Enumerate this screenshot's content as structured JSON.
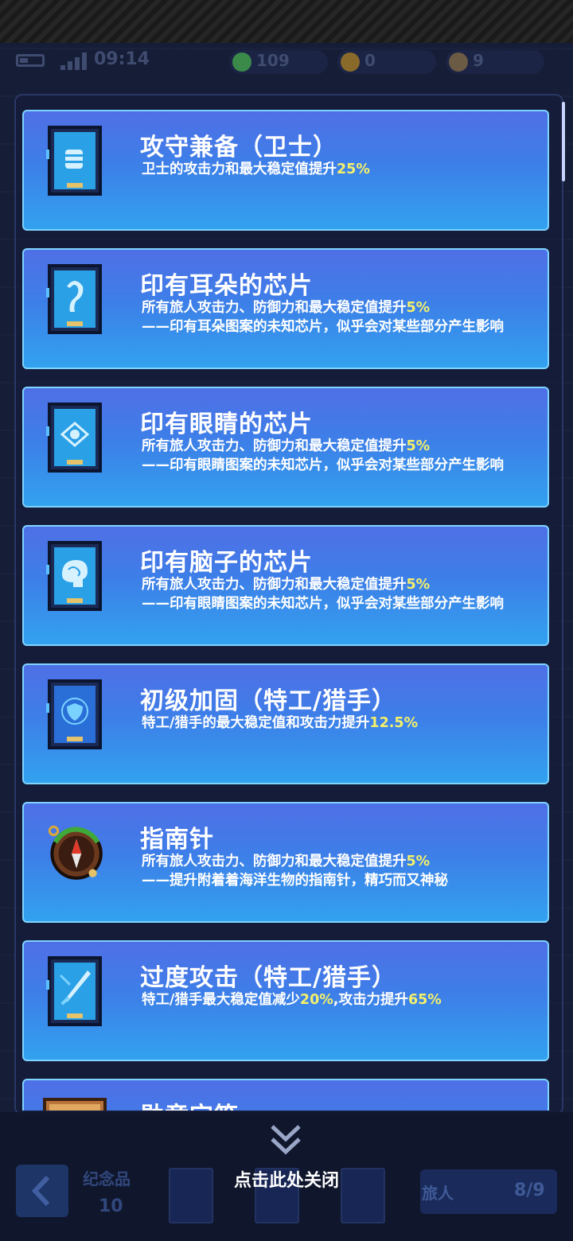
{
  "status": {
    "time": "09:14"
  },
  "currencies": [
    {
      "amount": "109",
      "icon": "green-gem-icon",
      "color": "#3c8a4a"
    },
    {
      "amount": "0",
      "icon": "gold-coin-icon",
      "color": "#8a6a2a"
    },
    {
      "amount": "9",
      "icon": "bronze-coin-icon",
      "color": "#6b5a44"
    }
  ],
  "cards": [
    {
      "title": "攻守兼备（卫士）",
      "desc_pre": "卫士的攻击力和最大稳定值提升",
      "desc_hl": "25%",
      "flavor": "",
      "icon": "chip-canister-icon"
    },
    {
      "title": "印有耳朵的芯片",
      "desc_pre": "所有旅人攻击力、防御力和最大稳定值提升",
      "desc_hl": "5%",
      "flavor": "——印有耳朵图案的未知芯片，似乎会对某些部分产生影响",
      "icon": "chip-ear-icon"
    },
    {
      "title": "印有眼睛的芯片",
      "desc_pre": "所有旅人攻击力、防御力和最大稳定值提升",
      "desc_hl": "5%",
      "flavor": "——印有眼睛图案的未知芯片，似乎会对某些部分产生影响",
      "icon": "chip-eye-icon"
    },
    {
      "title": "印有脑子的芯片",
      "desc_pre": "所有旅人攻击力、防御力和最大稳定值提升",
      "desc_hl": "5%",
      "flavor": "——印有眼睛图案的未知芯片，似乎会对某些部分产生影响",
      "icon": "chip-brain-icon"
    },
    {
      "title": "初级加固（特工/猎手）",
      "desc_pre": "特工/猎手的最大稳定值和攻击力提升",
      "desc_hl": "12.5%",
      "flavor": "",
      "icon": "chip-shield-icon"
    },
    {
      "title": "指南针",
      "desc_pre": "所有旅人攻击力、防御力和最大稳定值提升",
      "desc_hl": "5%",
      "flavor": "——提升附着着海洋生物的指南针，精巧而又神秘",
      "icon": "compass-icon"
    },
    {
      "title": "过度攻击（特工/猎手）",
      "desc_pre": "特工/猎手最大稳定值减少",
      "desc_hl": "20%",
      "desc_mid": ",攻击力提升",
      "desc_hl2": "65%",
      "flavor": "",
      "icon": "chip-sword-icon"
    },
    {
      "title": "勋章宝箱",
      "desc_pre": "",
      "desc_hl": "",
      "flavor": "",
      "icon": "treasure-chest-icon"
    }
  ],
  "footer": {
    "close_label": "点击此处关闭",
    "souvenir_label": "纪念品",
    "souvenir_count": "10",
    "traveler_label": "旅人",
    "traveler_count": "8/9"
  }
}
